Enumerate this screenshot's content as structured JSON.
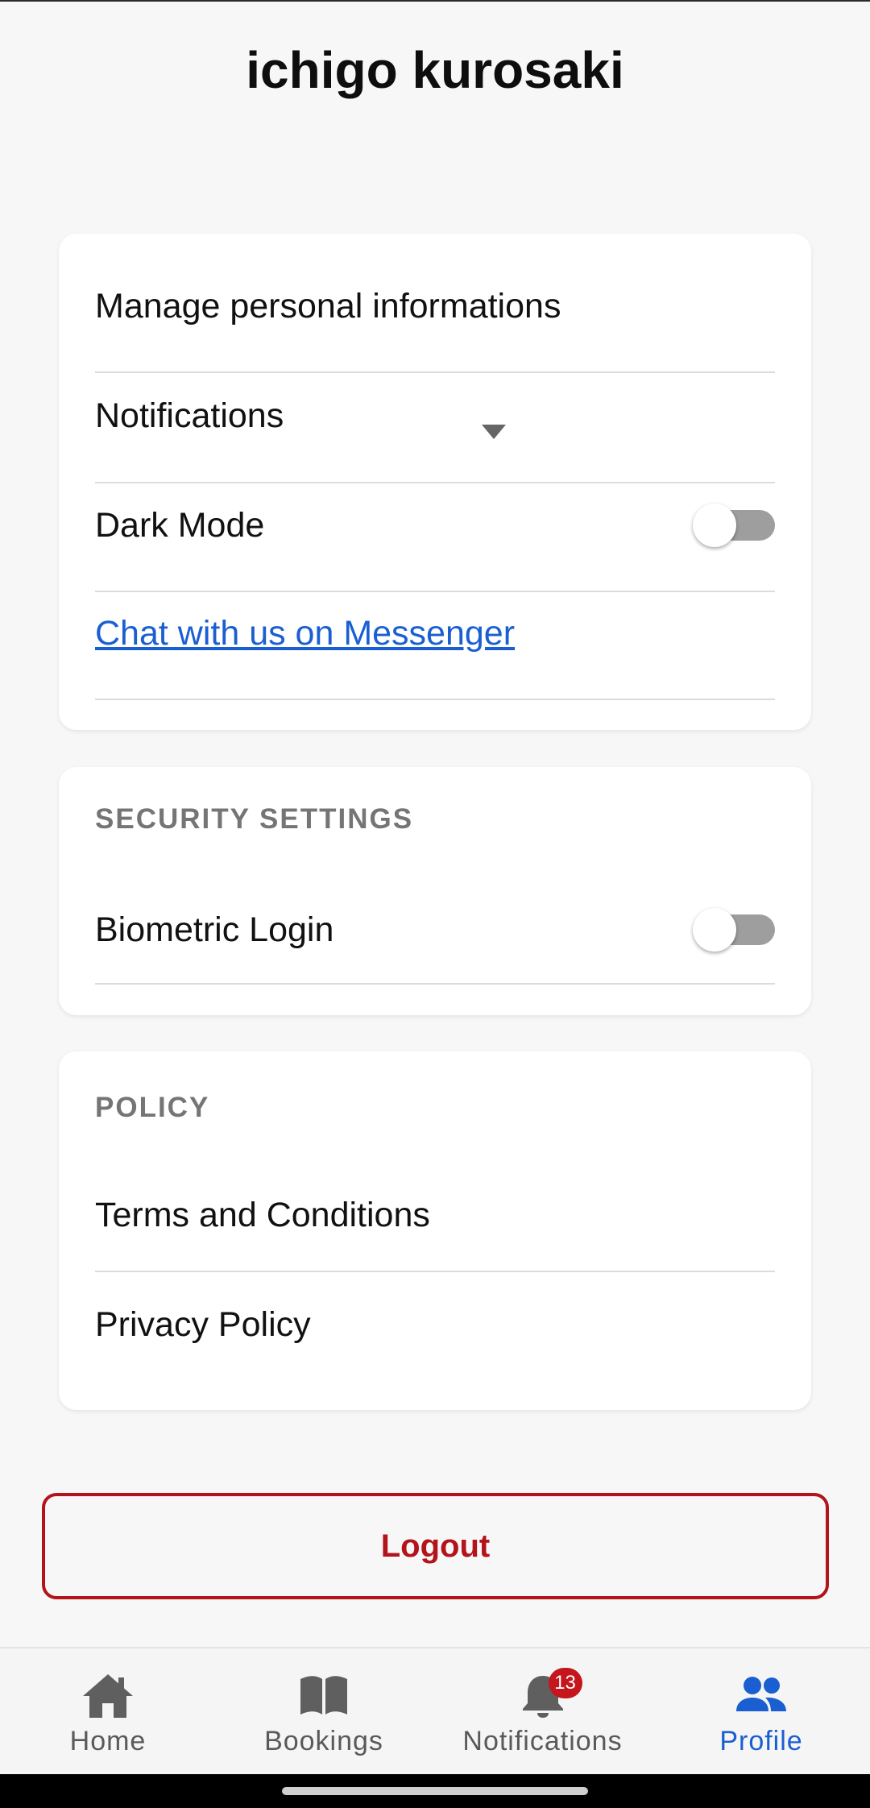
{
  "profile": {
    "name": "ichigo kurosaki"
  },
  "main_card": {
    "manage_label": "Manage personal informations",
    "notifications_label": "Notifications",
    "dark_mode_label": "Dark Mode",
    "dark_mode_on": false,
    "messenger_link": "Chat with us on Messenger"
  },
  "security": {
    "header": "SECURITY SETTINGS",
    "biometric_label": "Biometric Login",
    "biometric_on": false
  },
  "policy": {
    "header": "POLICY",
    "terms_label": "Terms and Conditions",
    "privacy_label": "Privacy Policy"
  },
  "logout_label": "Logout",
  "nav": {
    "items": [
      {
        "label": "Home",
        "icon": "home-icon",
        "active": false
      },
      {
        "label": "Bookings",
        "icon": "book-icon",
        "active": false
      },
      {
        "label": "Notifications",
        "icon": "bell-icon",
        "active": false,
        "badge": "13"
      },
      {
        "label": "Profile",
        "icon": "people-icon",
        "active": true
      }
    ]
  },
  "colors": {
    "accent": "#1a5fd1",
    "danger": "#b3131b",
    "badge": "#c4161c",
    "toggle_off": "#9e9e9e"
  }
}
